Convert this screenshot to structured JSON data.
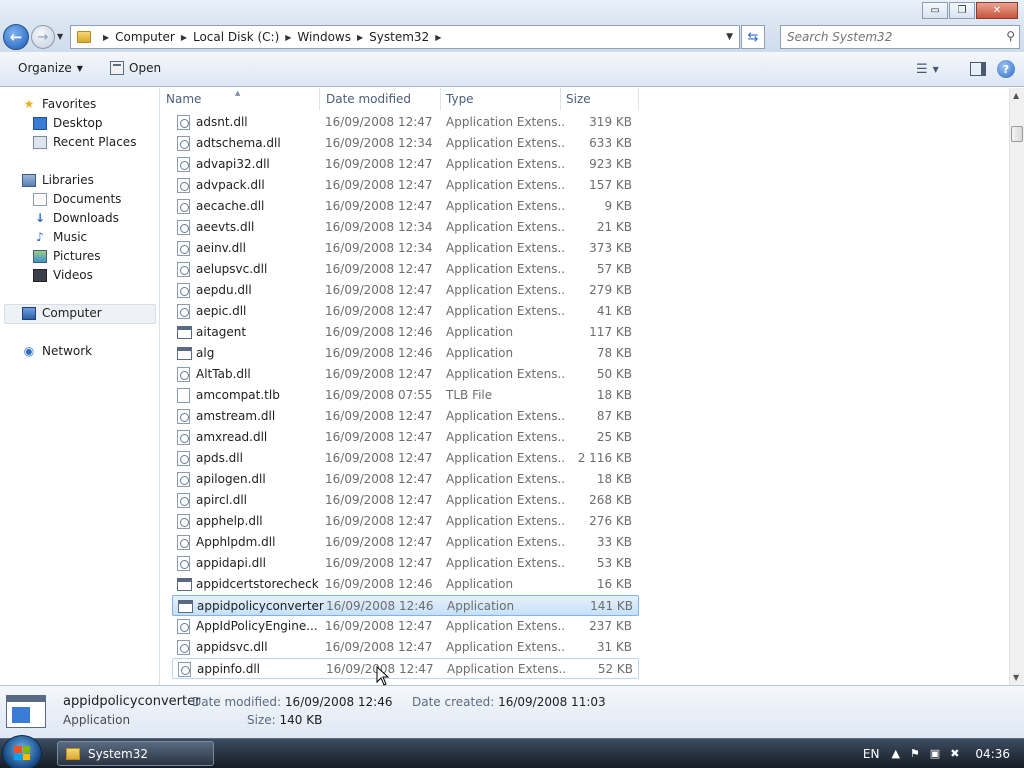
{
  "window": {
    "controls": {
      "minimize": "▭",
      "maximize": "❐",
      "close": "✕"
    }
  },
  "address": {
    "back_glyph": "←",
    "forward_glyph": "→",
    "breadcrumbs": [
      "Computer",
      "Local Disk (C:)",
      "Windows",
      "System32"
    ],
    "refresh_glyph": "⇆"
  },
  "search": {
    "placeholder": "Search System32",
    "icon": "search-icon"
  },
  "toolbar": {
    "organize_label": "Organize",
    "open_label": "Open"
  },
  "nav": {
    "favorites": {
      "label": "Favorites",
      "items": [
        "Desktop",
        "Recent Places"
      ]
    },
    "libraries": {
      "label": "Libraries",
      "items": [
        "Documents",
        "Downloads",
        "Music",
        "Pictures",
        "Videos"
      ]
    },
    "computer": "Computer",
    "network": "Network"
  },
  "columns": {
    "name": "Name",
    "date": "Date modified",
    "type": "Type",
    "size": "Size"
  },
  "files": [
    {
      "name": "adsnt.dll",
      "date": "16/09/2008 12:47",
      "type": "Application Extens...",
      "size": "319 KB",
      "kind": "dll"
    },
    {
      "name": "adtschema.dll",
      "date": "16/09/2008 12:34",
      "type": "Application Extens...",
      "size": "633 KB",
      "kind": "dll"
    },
    {
      "name": "advapi32.dll",
      "date": "16/09/2008 12:47",
      "type": "Application Extens...",
      "size": "923 KB",
      "kind": "dll"
    },
    {
      "name": "advpack.dll",
      "date": "16/09/2008 12:47",
      "type": "Application Extens...",
      "size": "157 KB",
      "kind": "dll"
    },
    {
      "name": "aecache.dll",
      "date": "16/09/2008 12:47",
      "type": "Application Extens...",
      "size": "9 KB",
      "kind": "dll"
    },
    {
      "name": "aeevts.dll",
      "date": "16/09/2008 12:34",
      "type": "Application Extens...",
      "size": "21 KB",
      "kind": "dll"
    },
    {
      "name": "aeinv.dll",
      "date": "16/09/2008 12:34",
      "type": "Application Extens...",
      "size": "373 KB",
      "kind": "dll"
    },
    {
      "name": "aelupsvc.dll",
      "date": "16/09/2008 12:47",
      "type": "Application Extens...",
      "size": "57 KB",
      "kind": "dll"
    },
    {
      "name": "aepdu.dll",
      "date": "16/09/2008 12:47",
      "type": "Application Extens...",
      "size": "279 KB",
      "kind": "dll"
    },
    {
      "name": "aepic.dll",
      "date": "16/09/2008 12:47",
      "type": "Application Extens...",
      "size": "41 KB",
      "kind": "dll"
    },
    {
      "name": "aitagent",
      "date": "16/09/2008 12:46",
      "type": "Application",
      "size": "117 KB",
      "kind": "app"
    },
    {
      "name": "alg",
      "date": "16/09/2008 12:46",
      "type": "Application",
      "size": "78 KB",
      "kind": "app"
    },
    {
      "name": "AltTab.dll",
      "date": "16/09/2008 12:47",
      "type": "Application Extens...",
      "size": "50 KB",
      "kind": "dll"
    },
    {
      "name": "amcompat.tlb",
      "date": "16/09/2008 07:55",
      "type": "TLB File",
      "size": "18 KB",
      "kind": "file"
    },
    {
      "name": "amstream.dll",
      "date": "16/09/2008 12:47",
      "type": "Application Extens...",
      "size": "87 KB",
      "kind": "dll"
    },
    {
      "name": "amxread.dll",
      "date": "16/09/2008 12:47",
      "type": "Application Extens...",
      "size": "25 KB",
      "kind": "dll"
    },
    {
      "name": "apds.dll",
      "date": "16/09/2008 12:47",
      "type": "Application Extens...",
      "size": "2 116 KB",
      "kind": "dll"
    },
    {
      "name": "apilogen.dll",
      "date": "16/09/2008 12:47",
      "type": "Application Extens...",
      "size": "18 KB",
      "kind": "dll"
    },
    {
      "name": "apircl.dll",
      "date": "16/09/2008 12:47",
      "type": "Application Extens...",
      "size": "268 KB",
      "kind": "dll"
    },
    {
      "name": "apphelp.dll",
      "date": "16/09/2008 12:47",
      "type": "Application Extens...",
      "size": "276 KB",
      "kind": "dll"
    },
    {
      "name": "Apphlpdm.dll",
      "date": "16/09/2008 12:47",
      "type": "Application Extens...",
      "size": "33 KB",
      "kind": "dll"
    },
    {
      "name": "appidapi.dll",
      "date": "16/09/2008 12:47",
      "type": "Application Extens...",
      "size": "53 KB",
      "kind": "dll"
    },
    {
      "name": "appidcertstorecheck",
      "date": "16/09/2008 12:46",
      "type": "Application",
      "size": "16 KB",
      "kind": "app"
    },
    {
      "name": "appidpolicyconverter",
      "date": "16/09/2008 12:46",
      "type": "Application",
      "size": "141 KB",
      "kind": "app",
      "state": "selected"
    },
    {
      "name": "AppIdPolicyEngine...",
      "date": "16/09/2008 12:47",
      "type": "Application Extens...",
      "size": "237 KB",
      "kind": "dll"
    },
    {
      "name": "appidsvc.dll",
      "date": "16/09/2008 12:47",
      "type": "Application Extens...",
      "size": "31 KB",
      "kind": "dll"
    },
    {
      "name": "appinfo.dll",
      "date": "16/09/2008 12:47",
      "type": "Application Extens...",
      "size": "52 KB",
      "kind": "dll",
      "state": "hovered"
    }
  ],
  "details": {
    "name": "appidpolicyconverter",
    "type": "Application",
    "date_modified_label": "Date modified:",
    "date_modified": "16/09/2008 12:46",
    "date_created_label": "Date created:",
    "date_created": "16/09/2008 11:03",
    "size_label": "Size:",
    "size": "140 KB"
  },
  "taskbar": {
    "task_label": "System32",
    "language": "EN",
    "clock": "04:36"
  },
  "colors": {
    "selection": "#c6e0f8",
    "selection_border": "#7eb4ea",
    "header_text": "#4c607a",
    "secondary_text": "#6d6d6d"
  }
}
